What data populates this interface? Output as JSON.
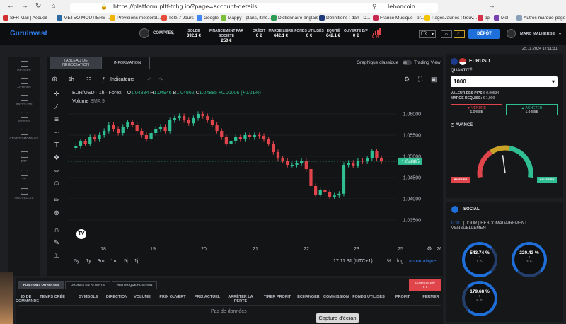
{
  "browser": {
    "url": "https://platform.pltf-tchg.io/?page=account-details",
    "search": "leboncoin",
    "bookmarks": [
      "SFR Mail | Accueil",
      "METEO MOUTIERS-...",
      "Prévisions météorol...",
      "Télé 7 Jours",
      "Google",
      "Mappy - plans, itiné...",
      "Dictionnaire anglais",
      "Définitions : dah - D...",
      "France Musique : pr...",
      "PagesJaunes : trouv...",
      "tip",
      "Mol",
      "Autres marque-page"
    ]
  },
  "topbar": {
    "logo": "GuruInvest",
    "comptes": "COMPTES",
    "stats": [
      {
        "label": "SOLDE",
        "value": "392.1 €"
      },
      {
        "label": "FINANCEMENT PAR SOCIÉTÉ",
        "value": "250 €"
      },
      {
        "label": "CRÉDIT",
        "value": "0 €"
      },
      {
        "label": "MARGE LIBRE",
        "value": "642.1 €"
      },
      {
        "label": "FONDS UTILISÉS",
        "value": "0 €"
      },
      {
        "label": "ÉQUITÉ",
        "value": "642.1 €"
      },
      {
        "label": "OUVERTE B/P",
        "value": "0 €"
      }
    ],
    "risk": "0 %",
    "lang": "FR",
    "deposit": "DÉPÔT",
    "user": "MARC MALHERBE",
    "date": "25.11.2024 17:11:31"
  },
  "sidebar": [
    "DEVISES",
    "ACTIONS",
    "PRODUITS",
    "INDICES",
    "CRYPTO-MONNAIE",
    "ETF",
    "TY",
    "NOUVELLES"
  ],
  "chartpanel": {
    "tab_left": "TABLEAU DE NÉGOCIATION",
    "tab_right": "INFORMATION",
    "mode_label": "Graphique classique",
    "mode_right": "Trading View",
    "interval": "1h",
    "indicators": "Indicateurs",
    "symbol_line": "EUR/USD · 1h · Forex",
    "ohlc": {
      "O": "1.04884",
      "H": "1.04946",
      "B": "1.04862",
      "C": "1.04885",
      "chg": "+0.00006 (+0.01%)"
    },
    "volume": "Volume",
    "sma": "SMA 9",
    "price_tag": "1.04885",
    "time_display": "17:11:31 (UTC+1)",
    "bottom_opts": [
      "5y",
      "1y",
      "3m",
      "1m",
      "5j",
      "1j"
    ],
    "log": "log",
    "auto": "automatique",
    "pct": "%"
  },
  "chart_data": {
    "type": "candlestick",
    "symbol": "EUR/USD",
    "interval": "1h",
    "x_ticks": [
      "18",
      "19",
      "20",
      "21",
      "22",
      "23",
      "25",
      "26"
    ],
    "y_ticks": [
      1.06,
      1.055,
      1.05,
      1.045,
      1.04,
      1.035
    ],
    "ylim": [
      1.0325,
      1.0615
    ],
    "closes": [
      1.0525,
      1.0535,
      1.053,
      1.0545,
      1.054,
      1.055,
      1.056,
      1.0575,
      1.0565,
      1.0555,
      1.057,
      1.058,
      1.0575,
      1.056,
      1.055,
      1.054,
      1.0555,
      1.0565,
      1.057,
      1.056,
      1.0585,
      1.059,
      1.0595,
      1.0585,
      1.0578,
      1.059,
      1.06,
      1.0595,
      1.0585,
      1.0575,
      1.056,
      1.0545,
      1.053,
      1.0535,
      1.0545,
      1.054,
      1.055,
      1.0545,
      1.055,
      1.0548,
      1.054,
      1.053,
      1.051,
      1.0495,
      1.049,
      1.048,
      1.048,
      1.0485,
      1.049,
      1.047,
      1.043,
      1.041,
      1.042,
      1.0415,
      1.0405,
      1.0408,
      1.0412,
      1.048,
      1.0485,
      1.0478,
      1.049,
      1.0488,
      1.0495,
      1.0512,
      1.0496,
      1.0488
    ]
  },
  "trade": {
    "symbol": "EURUSD",
    "qty_label": "QUANTITÉ",
    "qty": "1000",
    "pip_label": "VALEUR DES PIPS",
    "pip": "€ 0.09534",
    "margin_label": "MARGE REQUISE:",
    "margin": "€ 1,000",
    "sell": "VENDRE",
    "sell_price": "1.04885",
    "buy": "ACHETER",
    "buy_price": "1.04885",
    "advanced": "AVANCÉ",
    "bear": "BAISSIER",
    "bull": "HAUSSIER",
    "gauge": 0.46,
    "colors": {
      "red": "#e0454b",
      "green": "#2fbf92",
      "blue": "#1e6fd9"
    }
  },
  "social": {
    "title": "SOCIAL",
    "tabs": [
      "TOUT",
      "JOUR",
      "HEBDOMADAIREMENT",
      "MENSUELLEMENT"
    ],
    "rings": [
      {
        "value": "543.74 %",
        "rank": "1",
        "name": "I. R."
      },
      {
        "value": "220.43 %",
        "rank": "8",
        "name": "N. L."
      },
      {
        "value": "179.68 %",
        "rank": "9",
        "name": "S. R."
      }
    ]
  },
  "positions": {
    "tabs": [
      "POSITIONS OUVERTES",
      "ORDRES EN ATTENTE",
      "HISTORIQUE POSITION"
    ],
    "close_btn": "Ouverture B/P",
    "close_val": "0 €",
    "columns": [
      "ID DE COMMANDE",
      "TEMPS CRÉÉ",
      "SYMBOLE",
      "DIRECTION",
      "VOLUME",
      "PRIX OUVERT",
      "PRIX ACTUEL",
      "ARRÊTER LA PERTE",
      "TIRER PROFIT",
      "ÉCHANGER",
      "COMMISSION",
      "FONDS UTILISÉS",
      "PROFIT",
      "FERMER"
    ],
    "empty": "Pas de données"
  },
  "overlay": "Capture d'écran"
}
